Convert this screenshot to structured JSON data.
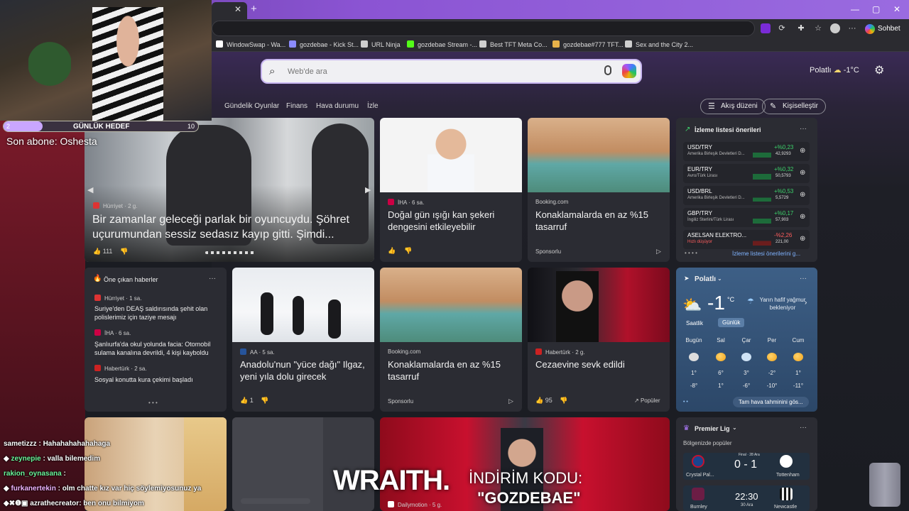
{
  "browser": {
    "window_controls": [
      "—",
      "▢",
      "✕"
    ],
    "tab_close": "✕",
    "tab_new": "+",
    "sohbet_label": "Sohbet et",
    "bookmarks": [
      {
        "label": "WindowSwap - Wa...",
        "color": "#ffffff"
      },
      {
        "label": "gozdebae - Kick St...",
        "color": "#8b8bff"
      },
      {
        "label": "URL Ninja",
        "color": "#cfcfcf"
      },
      {
        "label": "gozdebae Stream -...",
        "color": "#53fc18"
      },
      {
        "label": "Best TFT Meta Co...",
        "color": "#cfcfcf"
      },
      {
        "label": "gozdebae#777 TFT...",
        "color": "#e7b24a"
      },
      {
        "label": "Sex and the City 2...",
        "color": "#cfcfcf"
      }
    ]
  },
  "search": {
    "placeholder": "Web'de ara"
  },
  "header": {
    "location": "Polatlı",
    "temp": "-1°C"
  },
  "nav": {
    "items": [
      "Gündelik Oyunlar",
      "Finans",
      "Hava durumu",
      "İzle"
    ],
    "feed_layout": "Akış düzeni",
    "personalize": "Kişiselleştir"
  },
  "stream": {
    "goal_label": "GÜNLÜK HEDEF",
    "goal_current": "2",
    "goal_target": "10",
    "goal_fraction": 0.2,
    "last_sub": "Son abone: Oshesta",
    "ad_brand": "WRAITH.",
    "ad_line1": "İNDİRİM KODU:",
    "ad_line2": "\"GOZDEBAE\"",
    "chat": [
      {
        "name": "sametizzz",
        "msg": " : Hahahahahahahaga",
        "color": "#ffffff"
      },
      {
        "name": "zeynepie",
        "msg": " : valla bilemedim",
        "color": "#6bf59a"
      },
      {
        "name": "rakion_oynasana",
        "msg": " :",
        "color": "#6bf59a"
      },
      {
        "name": "furkanertekin",
        "msg": " : olm chatte kız var hiç söylemiyosunuz ya",
        "color": "#f0b4ff"
      },
      {
        "name": "azrathecreator",
        "msg": ": ben onu bilmiyom",
        "color": "#ffffff"
      }
    ]
  },
  "hero": {
    "source": "Hürriyet · 2 g.",
    "title": "Bir zamanlar geleceği parlak bir oyuncuydu. Şöhret uçurumundan sessiz sedasız kayıp gitti. Şimdi...",
    "likes": "111"
  },
  "cards": {
    "c1": {
      "source": "İHA · 6 sa.",
      "title": "Doğal gün ışığı kan şekeri dengesini etkileyebilir"
    },
    "c2": {
      "source": "Booking.com",
      "title": "Konaklamalarda en az %15 tasarruf",
      "sponsor": "Sponsorlu"
    },
    "c3": {
      "source": "AA · 5 sa.",
      "title": "Anadolu'nun \"yüce dağı\" Ilgaz, yeni yıla dolu girecek",
      "likes": "1"
    },
    "c4": {
      "source": "Booking.com",
      "title": "Konaklamalarda en az %15 tasarruf",
      "sponsor": "Sponsorlu"
    },
    "c5": {
      "source": "Habertürk · 2 g.",
      "title": "Cezaevine sevk edildi",
      "likes": "95",
      "popular": "Popüler"
    },
    "c6": {
      "source": "Dailymotion · 5 g."
    }
  },
  "headlines": {
    "title": "Öne çıkan haberler",
    "items": [
      {
        "source": "Hürriyet · 1 sa.",
        "text": "Suriye'den DEAŞ saldırısında şehit olan polislerimiz için taziye mesajı",
        "color": "#d33"
      },
      {
        "source": "İHA · 6 sa.",
        "text": "Şanlıurfa'da okul yolunda facia: Otomobil sulama kanalına devrildi, 4 kişi kayboldu",
        "color": "#c04"
      },
      {
        "source": "Habertürk · 2 sa.",
        "text": "Sosyal konutta kura çekimi başladı",
        "color": "#c22"
      }
    ]
  },
  "watchlist": {
    "title": "İzleme listesi önerileri",
    "more": "İzleme listesi önerilerini g...",
    "rows": [
      {
        "sym": "USD/TRY",
        "name": "Amerika Birleşik Devletleri D...",
        "change": "+%0,23",
        "value": "42,9293",
        "up": true
      },
      {
        "sym": "EUR/TRY",
        "name": "Avro/Türk Lirası",
        "change": "+%0,32",
        "value": "50,5793",
        "up": true
      },
      {
        "sym": "USD/BRL",
        "name": "Amerika Birleşik Devletleri D...",
        "change": "+%0,53",
        "value": "5,5729",
        "up": true
      },
      {
        "sym": "GBP/TRY",
        "name": "İngiliz Sterlini/Türk Lirası",
        "change": "+%0,17",
        "value": "57,903",
        "up": true
      },
      {
        "sym": "ASELSAN ELEKTRO...",
        "name": "Hızlı düşüyor",
        "change": "-%2,26",
        "value": "221,00",
        "up": false
      }
    ]
  },
  "weather": {
    "city": "Polatlı",
    "temp": "-1",
    "unit": "°C",
    "desc": "Yarın hafif yağmur bekleniyor",
    "tab_hourly": "Saatlik",
    "tab_daily": "Günlük",
    "days": [
      {
        "d": "Bugün",
        "hi": "1°",
        "lo": "-8°"
      },
      {
        "d": "Sal",
        "hi": "6°",
        "lo": "1°"
      },
      {
        "d": "Çar",
        "hi": "3°",
        "lo": "-6°"
      },
      {
        "d": "Per",
        "hi": "-2°",
        "lo": "-10°"
      },
      {
        "d": "Cum",
        "hi": "1°",
        "lo": "-11°"
      }
    ],
    "more": "Tam hava tahminini gös..."
  },
  "football": {
    "title": "Premier Lig",
    "sub": "Bölgenizde popüler",
    "m1": {
      "home": "Crystal Pal...",
      "away": "Tottenham",
      "status": "Final · 28 Ara",
      "score": "0 - 1"
    },
    "m2": {
      "home": "Burnley",
      "away": "Newcastle",
      "time": "22:30",
      "date": "30 Ara"
    }
  }
}
